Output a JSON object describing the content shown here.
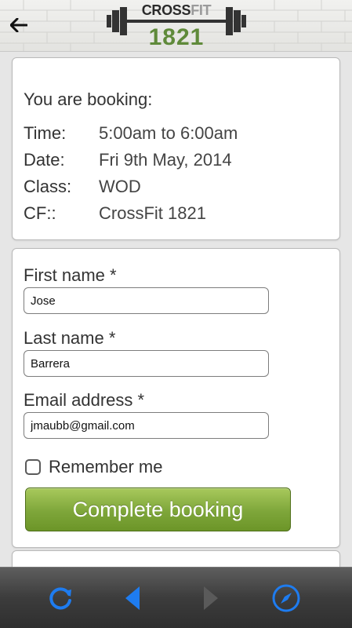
{
  "header": {
    "back_icon": "arrow-left-icon",
    "logo": {
      "top": "CROSS",
      "top_accent": "FIT",
      "bottom": "1821"
    }
  },
  "booking": {
    "title": "You are booking:",
    "rows": [
      {
        "key": "Time:",
        "value": "5:00am to 6:00am"
      },
      {
        "key": "Date:",
        "value": "Fri 9th May, 2014"
      },
      {
        "key": "Class:",
        "value": "WOD"
      },
      {
        "key": "CF::",
        "value": "CrossFit 1821"
      }
    ]
  },
  "form": {
    "first_name": {
      "label": "First name *",
      "value": "Jose"
    },
    "last_name": {
      "label": "Last name *",
      "value": "Barrera"
    },
    "email": {
      "label": "Email address *",
      "value": "jmaubb@gmail.com"
    },
    "remember_label": "Remember me",
    "remember_checked": false,
    "submit_label": "Complete booking"
  },
  "toolbar": {
    "items": [
      "refresh-icon",
      "back-icon",
      "forward-icon",
      "compass-icon"
    ],
    "accent": "#1e7cf0",
    "disabled": "#5a5a5a"
  },
  "colors": {
    "brand_green": "#5f8a3a",
    "button_green": "#7ea63a"
  }
}
